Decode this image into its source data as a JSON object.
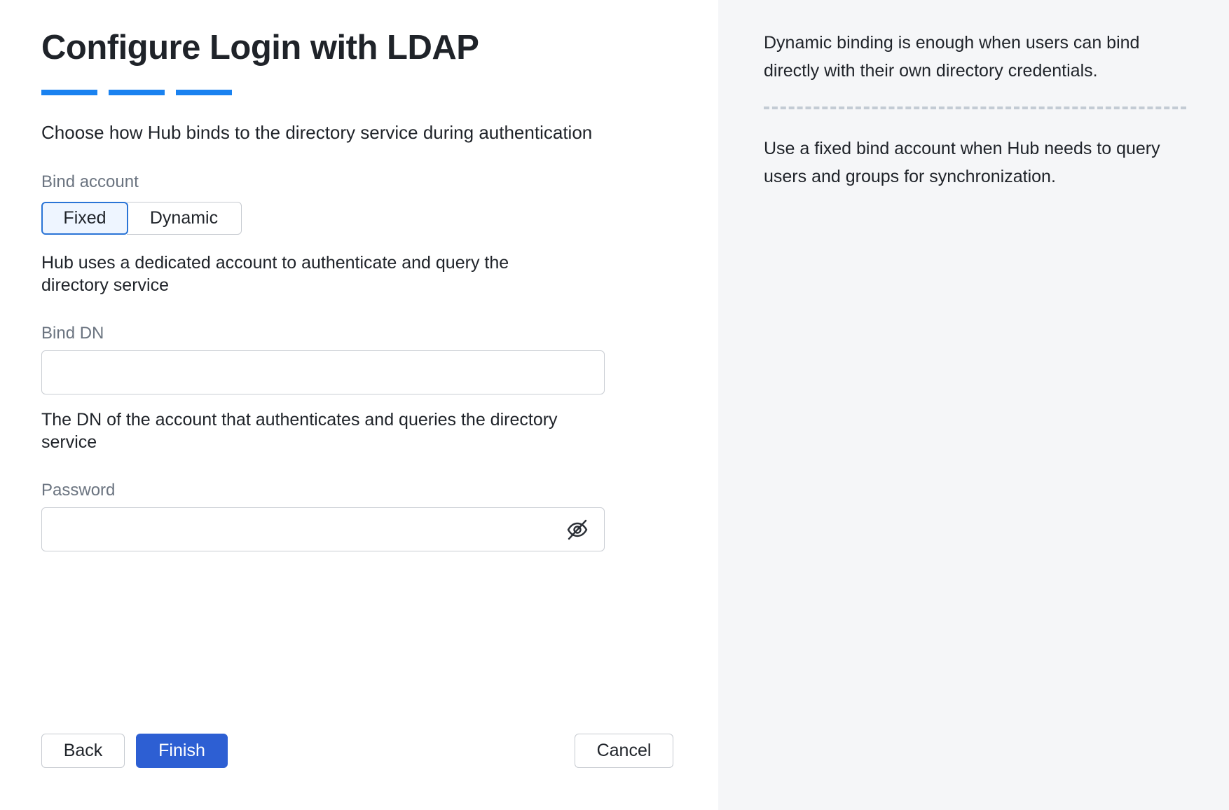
{
  "header": {
    "title": "Configure Login with LDAP",
    "steps": [
      "step-1",
      "step-2",
      "step-3"
    ],
    "accent_color": "#1a82f0"
  },
  "form": {
    "subtitle": "Choose how Hub binds to the directory service during authentication",
    "bind_account": {
      "label": "Bind account",
      "options": [
        "Fixed",
        "Dynamic"
      ],
      "selected": "Fixed",
      "help": "Hub uses a dedicated account to authenticate and query the directory service"
    },
    "bind_dn": {
      "label": "Bind DN",
      "value": "",
      "help": "The DN of the account that authenticates and queries the directory service"
    },
    "password": {
      "label": "Password",
      "value": "",
      "toggle_icon": "eye-off-icon"
    }
  },
  "footer": {
    "back_label": "Back",
    "finish_label": "Finish",
    "cancel_label": "Cancel",
    "primary_color": "#2d5fd3"
  },
  "aside": {
    "dynamic_hint": "Dynamic binding is enough when users can bind directly with their own directory credentials.",
    "fixed_hint": "Use a fixed bind account when Hub needs to query users and groups for synchronization.",
    "background_color": "#f5f6f8"
  }
}
